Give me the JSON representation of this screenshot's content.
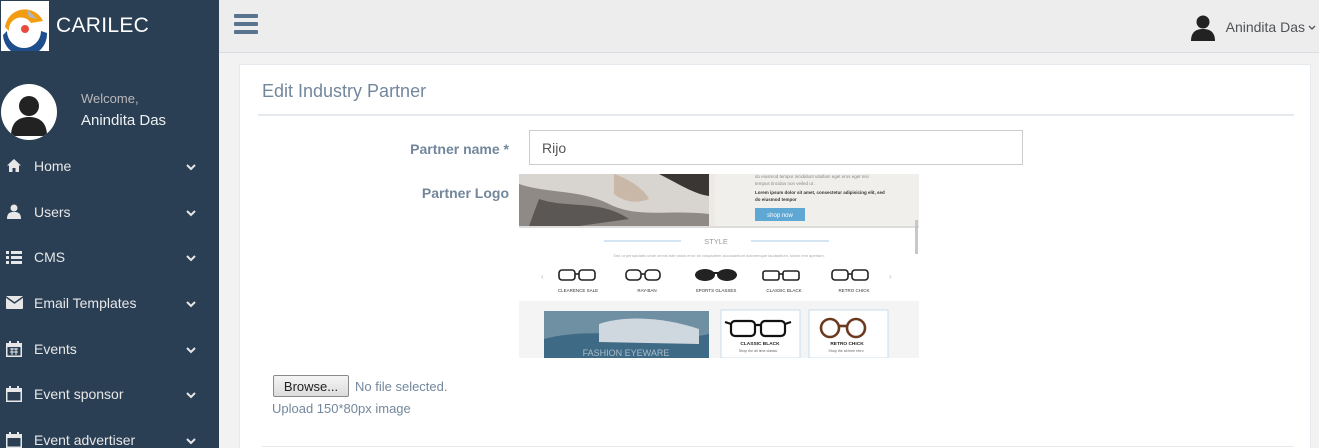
{
  "app": {
    "brand_name": "CARILEC"
  },
  "sidebar": {
    "welcome": "Welcome,",
    "user_name": "Anindita Das",
    "items": [
      {
        "label": "Home",
        "icon": "home-icon"
      },
      {
        "label": "Users",
        "icon": "user-icon"
      },
      {
        "label": "CMS",
        "icon": "list-icon"
      },
      {
        "label": "Email Templates",
        "icon": "envelope-icon"
      },
      {
        "label": "Events",
        "icon": "calendar-icon"
      },
      {
        "label": "Event sponsor",
        "icon": "calendar-icon"
      },
      {
        "label": "Event advertiser",
        "icon": "calendar-icon"
      }
    ]
  },
  "topbar": {
    "user_name": "Anindita Das"
  },
  "panel": {
    "title": "Edit Industry Partner",
    "partner_name_label": "Partner name *",
    "partner_name_value": "Rijo",
    "partner_logo_label": "Partner Logo",
    "browse_label": "Browse...",
    "file_status": "No file selected.",
    "upload_hint": "Upload 150*80px image"
  },
  "logo_preview": {
    "hero_text_1": "do eiusmod tempor incididunt uitullam eget eros eget nisi",
    "hero_text_2": "tempus tincidus non veiled ut .",
    "hero_text_3": "Lorem ipsum dolor sit amet, consectetur adipisicing elit, sed",
    "hero_text_4": "do eiusmod tempor",
    "shop_now": "shop now",
    "section_title": "STYLE",
    "section_sub": "Sed ut perspiciatis unde omnis iste natus error sit voluptatem accusantium doloremque laudantium, totam rem aperiam.",
    "categories": [
      "CLEARENCE SALE",
      "RAY-BAN",
      "SPORTS GLASSES",
      "CLASSIC BLACK",
      "RETRO CHICK"
    ],
    "banner_text": "FASHION EYEWARE",
    "card1_title": "CLASSIC BLACK",
    "card1_sub": "Shop the all time classic",
    "card2_title": "RETRO CHICK",
    "card2_sub": "Shop the all time retro"
  },
  "colors": {
    "sidebar_bg": "#2a3f54",
    "text_muted": "#73879c",
    "accent_button": "#5fa8d3"
  }
}
